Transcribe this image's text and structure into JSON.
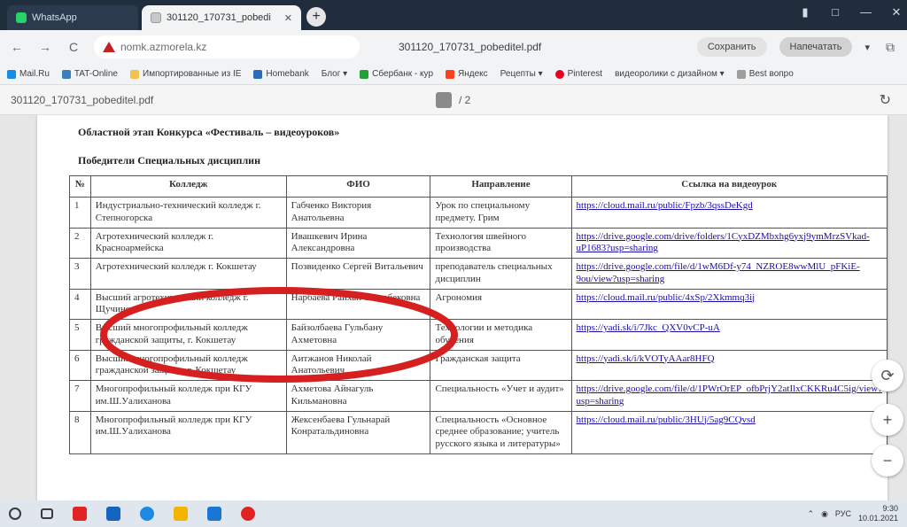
{
  "tabs": [
    {
      "label": "WhatsApp",
      "active": false
    },
    {
      "label": "301120_170731_pobedi",
      "active": true
    }
  ],
  "new_tab_icon": "+",
  "window_controls": [
    "▮",
    "□",
    "—",
    "✕"
  ],
  "address": {
    "back": "←",
    "forward": "→",
    "reload": "C",
    "url": "nomk.azmorela.kz",
    "doc_title": "301120_170731_pobeditel.pdf",
    "btn1": "Сохранить",
    "btn2": "Напечатать",
    "extra": "⧉"
  },
  "bookmarks": [
    {
      "label": "Mail.Ru",
      "color": "#168de2"
    },
    {
      "label": "TAT-Online",
      "color": "#3c7ebd"
    },
    {
      "label": "Импортированные из IE",
      "color": "#f2c14e"
    },
    {
      "label": "Homebank",
      "color": "#2a6ebb"
    },
    {
      "label": "Блог ▾",
      "color": "#9e9e9e"
    },
    {
      "label": "Сбербанк - куp",
      "color": "#21a038"
    },
    {
      "label": "Яндекс",
      "color": "#fc3f1d"
    },
    {
      "label": "Рецепты ▾",
      "color": "#9e9e9e"
    },
    {
      "label": "Pinterest",
      "color": "#e60023"
    },
    {
      "label": "видеоролики с дизайном ▾",
      "color": "#9e9e9e"
    },
    {
      "label": "Best вопро",
      "color": "#9e9e9e"
    }
  ],
  "pdf_toolbar": {
    "filename": "301120_170731_pobeditel.pdf",
    "pages": "/ 2",
    "rotate": "↻"
  },
  "document": {
    "title": "Областной этап Конкурса «Фестиваль – видеоуроков»",
    "subtitle": "Победители Специальных дисциплин",
    "headers": [
      "№",
      "Колледж",
      "ФИО",
      "Направление",
      "Ссылка на видеоурок"
    ],
    "rows": [
      [
        "1",
        "Индустриально-технический колледж г. Степногорска",
        "Габченко Виктория Анатольевна",
        "Урок по специальному предмету. Грим",
        "https://cloud.mail.ru/public/Fpzb/3qssDeKgd"
      ],
      [
        "2",
        "Агротехнический колледж г. Красноармейска",
        "Ивашкевич Ирина Александровна",
        "Технология швейного производства",
        "https://drive.google.com/drive/folders/1CyxDZMbxhg6yxj9ymMrzSVkad-uP1683?usp=sharing"
      ],
      [
        "3",
        "Агротехнический колледж г. Кокшетау",
        "Позвиденко Сергей Витальевич",
        "преподаватель специальных дисциплин",
        "https://drive.google.com/file/d/1wM6Df-y74_NZROE8wwMlU_pFKiE-9ou/view?usp=sharing"
      ],
      [
        "4",
        "Высший агротехнический колледж г. Щучинска",
        "Нарбаева Райхан Токарбековна",
        "Агрономия",
        "https://cloud.mail.ru/public/4xSp/2Xkmmq3ij"
      ],
      [
        "5",
        "Высший многопрофильный колледж гражданской защиты, г. Кокшетау",
        "Байзолбаева Гульбану Ахметовна",
        "Технологии и методика обучения",
        "https://yadi.sk/i/7Jkc_QXV0vCP-uA"
      ],
      [
        "6",
        "Высший многопрофильный колледж гражданской защиты, г. Кокшетау",
        "Аитжанов Николай Анатольевич",
        "Гражданская защита",
        "https://yadi.sk/i/kVOTyAAar8HFQ"
      ],
      [
        "7",
        "Многопрофильный колледж при КГУ им.Ш.Уалиханова",
        "Ахметова Айнагуль Кильмановна",
        "Специальность «Учет и аудит»",
        "https://drive.google.com/file/d/1PWrOrEP_ofbPrjY2atIlxCKKRu4C5ig/view?usp=sharing"
      ],
      [
        "8",
        "Многопрофильный колледж при КГУ им.Ш.Уалиханова",
        "Жексенбаева Гульнарай Конратальдиновна",
        "Специальность «Основное среднее образование; учитель русского языка и литературы»",
        "https://cloud.mail.ru/public/3HUj/5ag9CQvsd"
      ]
    ]
  },
  "zoom": {
    "reset": "⟳",
    "in": "+",
    "out": "−"
  },
  "taskbar": {
    "icons": [
      {
        "name": "windows-search-icon",
        "color": "#3a3a3a"
      },
      {
        "name": "task-view-icon",
        "color": "#3a3a3a"
      },
      {
        "name": "yandex-icon",
        "color": "#e02424"
      },
      {
        "name": "store-icon",
        "color": "#1565c0"
      },
      {
        "name": "edge-icon",
        "color": "#1e88e5"
      },
      {
        "name": "explorer-icon",
        "color": "#f5b400"
      },
      {
        "name": "briefcase-icon",
        "color": "#1976d2"
      },
      {
        "name": "yandex-browser-icon",
        "color": "#e02424"
      }
    ],
    "tray_lang": "РУС",
    "time": "9:30",
    "date": "10.01.2021"
  },
  "accent": {
    "annotation_oval": "#d61f1f",
    "link": "#1a0dab",
    "tabstrip": "#1f2d3d"
  }
}
